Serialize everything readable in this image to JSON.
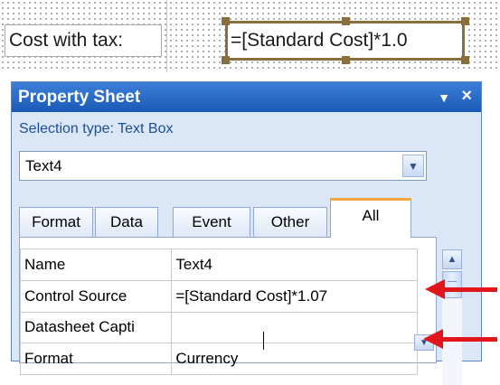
{
  "design": {
    "label_text": "Cost with tax:",
    "textbox_text": "=[Standard Cost]*1.0"
  },
  "property_sheet": {
    "title": "Property Sheet",
    "dropdown_glyph": "▼",
    "close_glyph": "×",
    "selection_type": "Selection type: Text Box",
    "object_selector_value": "Text4",
    "tabs": [
      {
        "label": "Format"
      },
      {
        "label": "Data"
      },
      {
        "label": "Event"
      },
      {
        "label": "Other"
      },
      {
        "label": "All",
        "active": true
      }
    ],
    "properties": [
      {
        "name": "Name",
        "value": "Text4"
      },
      {
        "name": "Control Source",
        "value": "=[Standard Cost]*1.07"
      },
      {
        "name": "Datasheet Capti",
        "value": ""
      },
      {
        "name": "Format",
        "value": "Currency"
      }
    ]
  },
  "icons": {
    "combo_arrow": "chevron-down-icon",
    "scroll_up": "chevron-up-icon",
    "annotation": "red-arrow-icon"
  },
  "colors": {
    "title_bar": "#1a5ab8",
    "active_tab_accent": "#f0a83a",
    "textbox_selection": "#8a6f3e",
    "annotation_arrow": "#e0161b"
  }
}
